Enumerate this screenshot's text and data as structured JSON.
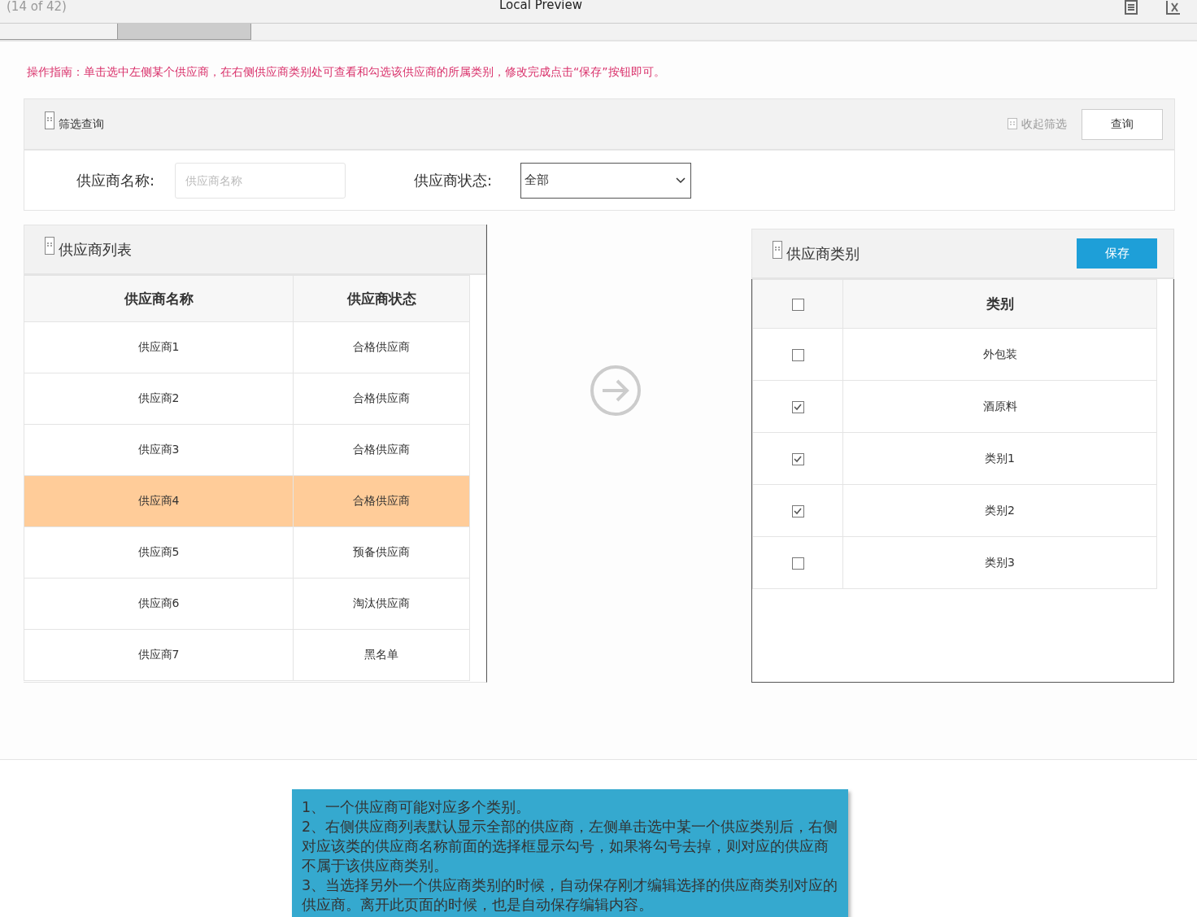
{
  "viewer": {
    "page_counter": "(14 of 42)",
    "title": "Local Preview"
  },
  "guide": "操作指南：单击选中左侧某个供应商，在右侧供应商类别处可查看和勾选该供应商的所属类别，修改完成点击“保存”按钮即可。",
  "filter": {
    "title": "筛选查询",
    "collapse": "收起筛选",
    "query_button": "查询",
    "name_label": "供应商名称:",
    "name_placeholder": "供应商名称",
    "status_label": "供应商状态:",
    "status_value": "全部"
  },
  "supplier_list": {
    "title": "供应商列表",
    "columns": [
      "供应商名称",
      "供应商状态"
    ],
    "rows": [
      {
        "name": "供应商1",
        "status": "合格供应商",
        "selected": false
      },
      {
        "name": "供应商2",
        "status": "合格供应商",
        "selected": false
      },
      {
        "name": "供应商3",
        "status": "合格供应商",
        "selected": false
      },
      {
        "name": "供应商4",
        "status": "合格供应商",
        "selected": true
      },
      {
        "name": "供应商5",
        "status": "预备供应商",
        "selected": false
      },
      {
        "name": "供应商6",
        "status": "淘汰供应商",
        "selected": false
      },
      {
        "name": "供应商7",
        "status": "黑名单",
        "selected": false
      }
    ]
  },
  "categories": {
    "title": "供应商类别",
    "save_button": "保存",
    "column": "类别",
    "all_checked": false,
    "rows": [
      {
        "name": "外包装",
        "checked": false
      },
      {
        "name": "酒原料",
        "checked": true
      },
      {
        "name": "类别1",
        "checked": true
      },
      {
        "name": "类别2",
        "checked": true
      },
      {
        "name": "类别3",
        "checked": false
      }
    ]
  },
  "notes": [
    "1、一个供应商可能对应多个类别。",
    "2、右侧供应商列表默认显示全部的供应商，左侧单击选中某一个供应类别后，右侧对应该类的供应商名称前面的选择框显示勾号，如果将勾号去掉，则对应的供应商不属于该供应商类别。",
    "3、当选择另外一个供应商类别的时候，自动保存刚才编辑选择的供应商类别对应的供应商。离开此页面的时候，也是自动保存编辑内容。"
  ]
}
